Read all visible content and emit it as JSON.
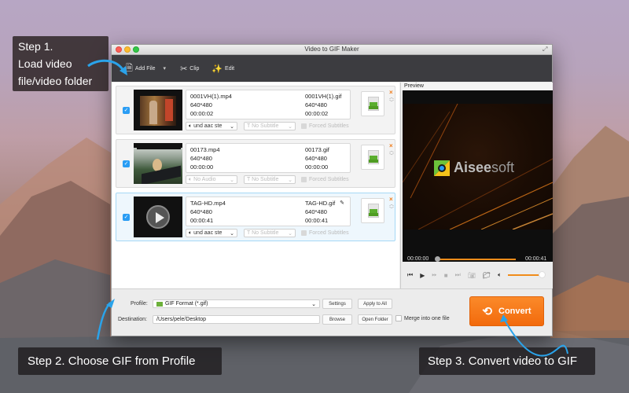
{
  "window": {
    "title": "Video to GIF Maker"
  },
  "toolbar": {
    "add_file": "Add File",
    "clip": "Clip",
    "edit": "Edit"
  },
  "files": [
    {
      "checked": true,
      "source_name": "0001VH(1).mp4",
      "source_resolution": "640*480",
      "source_duration": "00:00:02",
      "output_name": "0001VH(1).gif",
      "output_resolution": "640*480",
      "output_duration": "00:00:02",
      "audio": "und aac ste",
      "subtitle": "No Subtitle",
      "forced_subtitles": "Forced Subtitles"
    },
    {
      "checked": true,
      "source_name": "00173.mp4",
      "source_resolution": "640*480",
      "source_duration": "00:00:00",
      "output_name": "00173.gif",
      "output_resolution": "640*480",
      "output_duration": "00:00:00",
      "audio": "No Audio",
      "subtitle": "No Subtitle",
      "forced_subtitles": "Forced Subtitles"
    },
    {
      "checked": true,
      "selected": true,
      "source_name": "TAG-HD.mp4",
      "source_resolution": "640*480",
      "source_duration": "00:00:41",
      "output_name": "TAG-HD.gif",
      "output_resolution": "640*480",
      "output_duration": "00:00:41",
      "audio": "und aac ste",
      "subtitle": "No Subtitle",
      "forced_subtitles": "Forced Subtitles"
    }
  ],
  "format_badge": "GIF",
  "preview": {
    "label": "Preview",
    "brand_bold": "Aisee",
    "brand_light": "soft",
    "time_current": "00:00:00",
    "time_total": "00:00:41",
    "progress": 0,
    "volume": 1.0
  },
  "output": {
    "profile_label": "Profile:",
    "profile_value": "GIF Format (*.gif)",
    "settings": "Settings",
    "apply_to_all": "Apply to All",
    "destination_label": "Destination:",
    "destination_value": "/Users/pele/Desktop",
    "browse": "Browse",
    "open_folder": "Open Folder",
    "merge_label": "Merge into one file",
    "convert": "Convert"
  },
  "callouts": {
    "step1_line1": "Step 1.",
    "step1_line2": "Load video",
    "step1_line3": "file/video folder",
    "step2": "Step 2. Choose GIF from Profile",
    "step3": "Step 3. Convert video to GIF"
  },
  "colors": {
    "accent_orange": "#f47b17",
    "check_blue": "#2a9df4",
    "toolbar_dark": "#3c3c40"
  }
}
